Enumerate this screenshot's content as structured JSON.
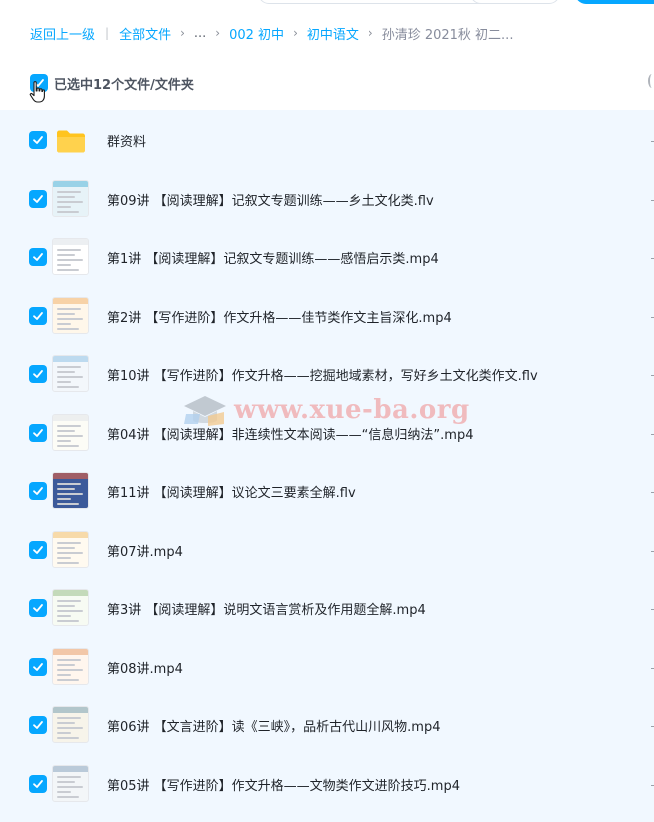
{
  "breadcrumb": {
    "back": "返回上一级",
    "all_files": "全部文件",
    "ellipsis": "...",
    "level1": "002 初中",
    "level2": "初中语文",
    "current": "孙清珍 2021秋 初二..."
  },
  "selection": {
    "label": "已选中12个文件/文件夹"
  },
  "watermark": "www.xue-ba.org",
  "files": [
    {
      "name": "群资料",
      "type": "folder"
    },
    {
      "name": "第09讲 【阅读理解】记叙文专题训练——乡土文化类.flv",
      "type": "video"
    },
    {
      "name": "第1讲 【阅读理解】记叙文专题训练——感悟启示类.mp4",
      "type": "video"
    },
    {
      "name": "第2讲 【写作进阶】作文升格——佳节类作文主旨深化.mp4",
      "type": "video"
    },
    {
      "name": "第10讲 【写作进阶】作文升格——挖掘地域素材，写好乡土文化类作文.flv",
      "type": "video"
    },
    {
      "name": "第04讲 【阅读理解】非连续性文本阅读——“信息归纳法”.mp4",
      "type": "video"
    },
    {
      "name": "第11讲 【阅读理解】议论文三要素全解.flv",
      "type": "video"
    },
    {
      "name": "第07讲.mp4",
      "type": "video"
    },
    {
      "name": "第3讲 【阅读理解】说明文语言赏析及作用题全解.mp4",
      "type": "video"
    },
    {
      "name": "第08讲.mp4",
      "type": "video"
    },
    {
      "name": "第06讲 【文言进阶】读《三峡》，品析古代山川风物.mp4",
      "type": "video"
    },
    {
      "name": "第05讲 【写作进阶】作文升格——文物类作文进阶技巧.mp4",
      "type": "video"
    }
  ],
  "colors": {
    "accent": "#06a7ff",
    "list_bg": "#f1f8ff",
    "folder": "#ffc41f"
  }
}
